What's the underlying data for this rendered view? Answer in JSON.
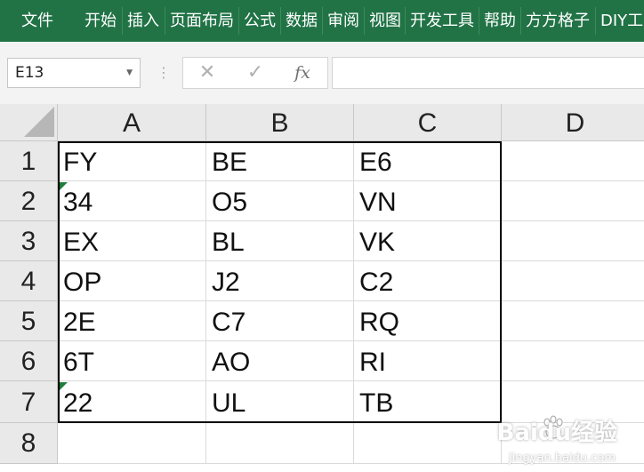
{
  "ribbon": {
    "tabs": [
      {
        "label": "文件"
      },
      {
        "label": "开始"
      },
      {
        "label": "插入"
      },
      {
        "label": "页面布局"
      },
      {
        "label": "公式"
      },
      {
        "label": "数据"
      },
      {
        "label": "审阅"
      },
      {
        "label": "视图"
      },
      {
        "label": "开发工具"
      },
      {
        "label": "帮助"
      },
      {
        "label": "方方格子"
      },
      {
        "label": "DIY工具箱"
      }
    ]
  },
  "formula_bar": {
    "name_box": "E13",
    "cancel_icon": "✕",
    "enter_icon": "✓",
    "fx_label": "fx",
    "formula": ""
  },
  "sheet": {
    "columns": [
      "A",
      "B",
      "C",
      "D"
    ],
    "rows": [
      "1",
      "2",
      "3",
      "4",
      "5",
      "6",
      "7",
      "8"
    ],
    "cells": [
      [
        "FY",
        "BE",
        "E6",
        ""
      ],
      [
        "34",
        "O5",
        "VN",
        ""
      ],
      [
        "EX",
        "BL",
        "VK",
        ""
      ],
      [
        "OP",
        "J2",
        "C2",
        ""
      ],
      [
        "2E",
        "C7",
        "RQ",
        ""
      ],
      [
        "6T",
        "AO",
        "RI",
        ""
      ],
      [
        "22",
        "UL",
        "TB",
        ""
      ],
      [
        "",
        "",
        "",
        ""
      ]
    ],
    "error_indicator_color": "#1e7e3a",
    "accent_color": "#217346"
  },
  "watermark": {
    "text": "Baidu经验",
    "subtext": "jingyan.baidu.com"
  }
}
